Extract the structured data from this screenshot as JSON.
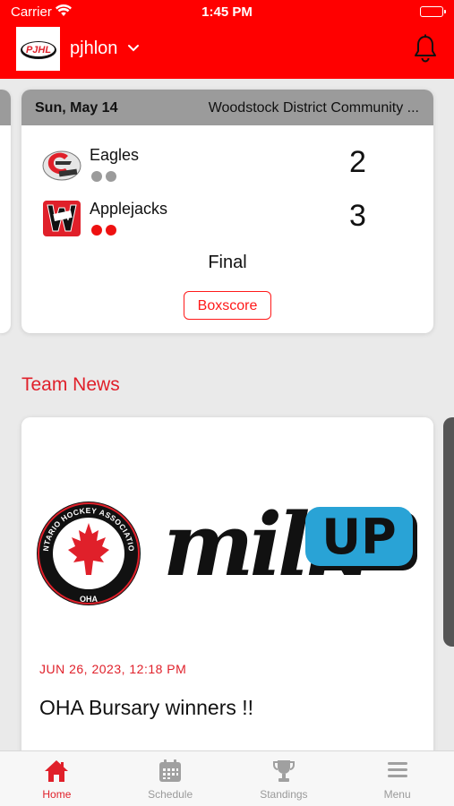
{
  "status_bar": {
    "carrier": "Carrier",
    "time": "1:45 PM"
  },
  "header": {
    "logo_text": "PJHL",
    "org_name": "pjhlon"
  },
  "game": {
    "date": "Sun, May 14",
    "venue": "Woodstock District Community ...",
    "status": "Final",
    "boxscore_label": "Boxscore",
    "teams": [
      {
        "name": "Eagles",
        "score": "2",
        "dot_color": "#9b9b9b"
      },
      {
        "name": "Applejacks",
        "score": "3",
        "dot_color": "#ee1111"
      }
    ]
  },
  "team_news": {
    "section_title": "Team News",
    "article": {
      "date": "JUN 26, 2023, 12:18 PM",
      "title": "OHA Bursary winners !!",
      "image_text": {
        "seal_top": "ONTARIO HOCKEY ASSOCIATION",
        "seal_bottom": "OHA",
        "brand_milk": "milk",
        "brand_up": "UP"
      }
    }
  },
  "tabs": [
    {
      "label": "Home",
      "icon": "home-icon",
      "active": true
    },
    {
      "label": "Schedule",
      "icon": "calendar-icon",
      "active": false
    },
    {
      "label": "Standings",
      "icon": "trophy-icon",
      "active": false
    },
    {
      "label": "Menu",
      "icon": "menu-icon",
      "active": false
    }
  ],
  "colors": {
    "brand_red": "#ff0000",
    "accent_red": "#e0202a",
    "card_header_gray": "#9b9b9b"
  }
}
